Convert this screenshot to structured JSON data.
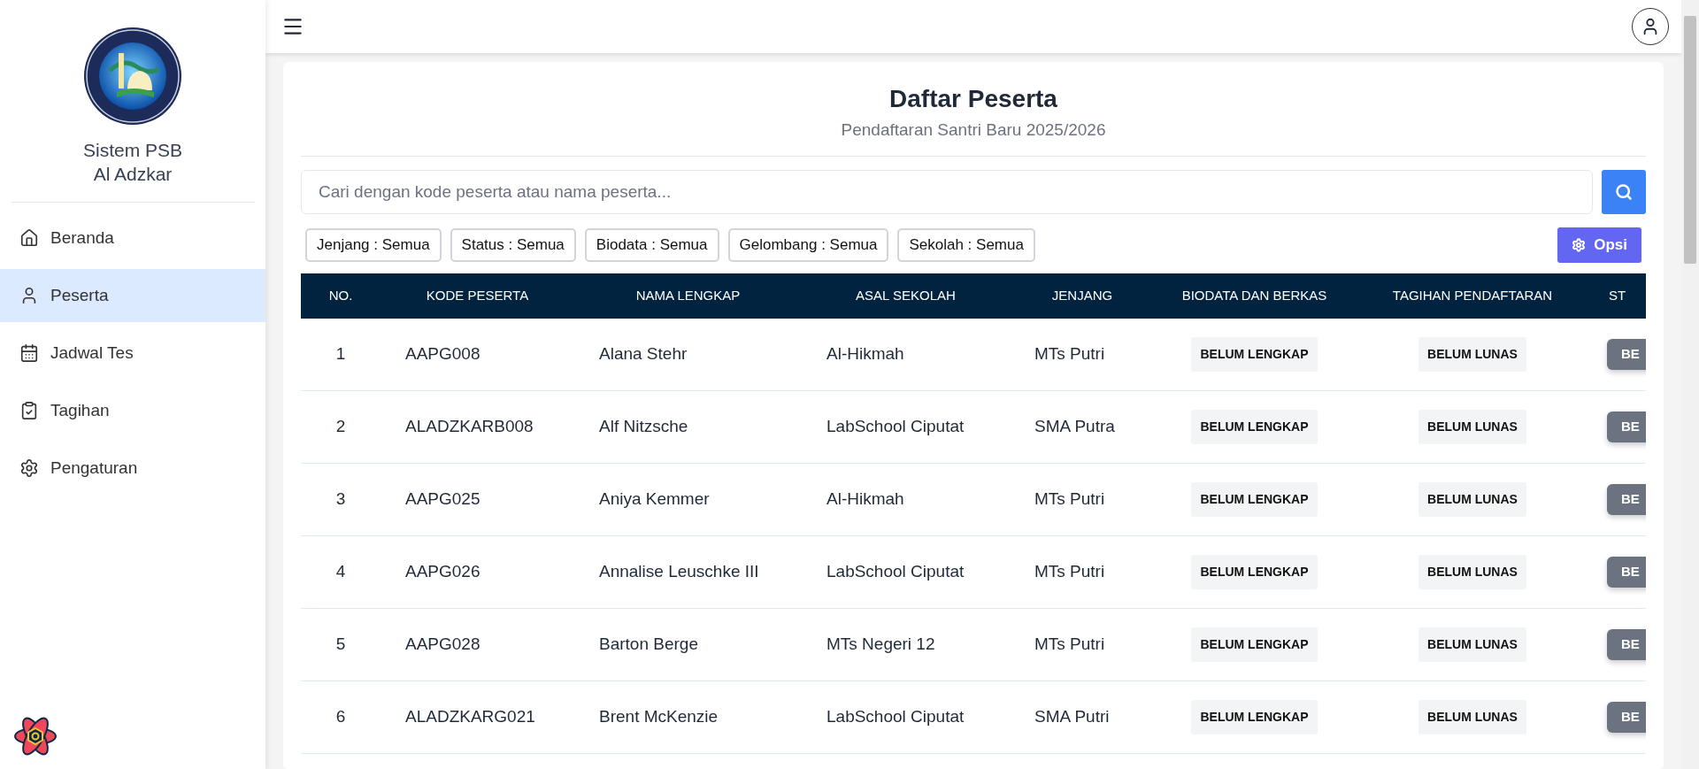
{
  "sidebar": {
    "title_lines": [
      "Sistem PSB",
      "Al Adzkar"
    ],
    "items": [
      {
        "kind": "home",
        "label": "Beranda",
        "selected": false
      },
      {
        "kind": "user",
        "label": "Peserta",
        "selected": true
      },
      {
        "kind": "calendar",
        "label": "Jadwal Tes",
        "selected": false
      },
      {
        "kind": "clipboard",
        "label": "Tagihan",
        "selected": false
      },
      {
        "kind": "gear",
        "label": "Pengaturan",
        "selected": false
      }
    ]
  },
  "page": {
    "title": "Daftar Peserta",
    "subtitle": "Pendaftaran Santri Baru 2025/2026"
  },
  "search": {
    "placeholder": "Cari dengan kode peserta atau nama peserta..."
  },
  "filters": [
    "Jenjang : Semua",
    "Status : Semua",
    "Biodata : Semua",
    "Gelombang : Semua",
    "Sekolah : Semua"
  ],
  "options_button": "Opsi",
  "table": {
    "columns": [
      "NO.",
      "KODE PESERTA",
      "NAMA LENGKAP",
      "ASAL SEKOLAH",
      "JENJANG",
      "BIODATA DAN BERKAS",
      "TAGIHAN PENDAFTARAN",
      "ST"
    ],
    "rows": [
      {
        "no": "1",
        "code": "AAPG008",
        "name": "Alana Stehr",
        "school": "Al-Hikmah",
        "level": "MTs Putri",
        "biodata": "BELUM LENGKAP",
        "bill": "BELUM LUNAS",
        "status": "BE"
      },
      {
        "no": "2",
        "code": "ALADZKARB008",
        "name": "Alf Nitzsche",
        "school": "LabSchool Ciputat",
        "level": "SMA Putra",
        "biodata": "BELUM LENGKAP",
        "bill": "BELUM LUNAS",
        "status": "BE"
      },
      {
        "no": "3",
        "code": "AAPG025",
        "name": "Aniya Kemmer",
        "school": "Al-Hikmah",
        "level": "MTs Putri",
        "biodata": "BELUM LENGKAP",
        "bill": "BELUM LUNAS",
        "status": "BE"
      },
      {
        "no": "4",
        "code": "AAPG026",
        "name": "Annalise Leuschke III",
        "school": "LabSchool Ciputat",
        "level": "MTs Putri",
        "biodata": "BELUM LENGKAP",
        "bill": "BELUM LUNAS",
        "status": "BE"
      },
      {
        "no": "5",
        "code": "AAPG028",
        "name": "Barton Berge",
        "school": "MTs Negeri 12",
        "level": "MTs Putri",
        "biodata": "BELUM LENGKAP",
        "bill": "BELUM LUNAS",
        "status": "BE"
      },
      {
        "no": "6",
        "code": "ALADZKARG021",
        "name": "Brent McKenzie",
        "school": "LabSchool Ciputat",
        "level": "SMA Putri",
        "biodata": "BELUM LENGKAP",
        "bill": "BELUM LUNAS",
        "status": "BE"
      }
    ]
  }
}
